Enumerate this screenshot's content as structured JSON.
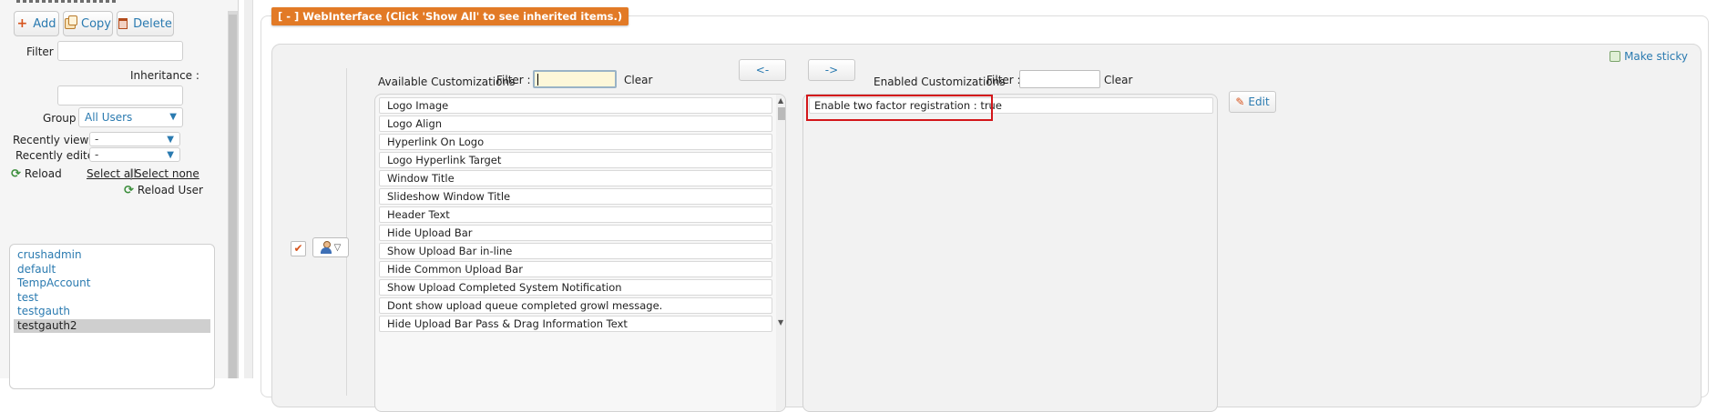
{
  "sidebar": {
    "buttons": {
      "add": "Add",
      "copy": "Copy",
      "delete": "Delete"
    },
    "filter_label": "Filter :",
    "inheritance_label": "Inheritance :",
    "group_label": "Group :",
    "group_value": "All Users",
    "recently_viewed_label": "Recently viewed :",
    "recently_viewed_value": "-",
    "recently_edited_label": "Recently edited :",
    "recently_edited_value": "-",
    "reload": "Reload",
    "select_all": "Select all",
    "separator": "|",
    "select_none": "Select none",
    "reload_user": "Reload User",
    "users": [
      "crushadmin",
      "default",
      "TempAccount",
      "test",
      "testgauth",
      "testgauth2"
    ],
    "selected_user": "testgauth2"
  },
  "main": {
    "section_tag": "[ - ] WebInterface (Click 'Show All' to see inherited items.)",
    "make_sticky": "Make sticky",
    "available_label": "Available Customizations",
    "filter_label": "Filter :",
    "clear": "Clear",
    "move_left": "<-",
    "move_right": "->",
    "enabled_label": "Enabled Customizations",
    "edit": "Edit",
    "available_items": [
      "Logo Image",
      "Logo Align",
      "Hyperlink On Logo",
      "Logo Hyperlink Target",
      "Window Title",
      "Slideshow Window Title",
      "Header Text",
      "Hide Upload Bar",
      "Show Upload Bar in-line",
      "Hide Common Upload Bar",
      "Show Upload Completed System Notification",
      "Dont show upload queue completed growl message.",
      "Hide Upload Bar Pass & Drag Information Text"
    ],
    "enabled_items": [
      "Enable two factor registration : true"
    ]
  },
  "colors": {
    "accent": "#e27a26",
    "link": "#2a7ab0",
    "highlight": "#d3161a"
  }
}
